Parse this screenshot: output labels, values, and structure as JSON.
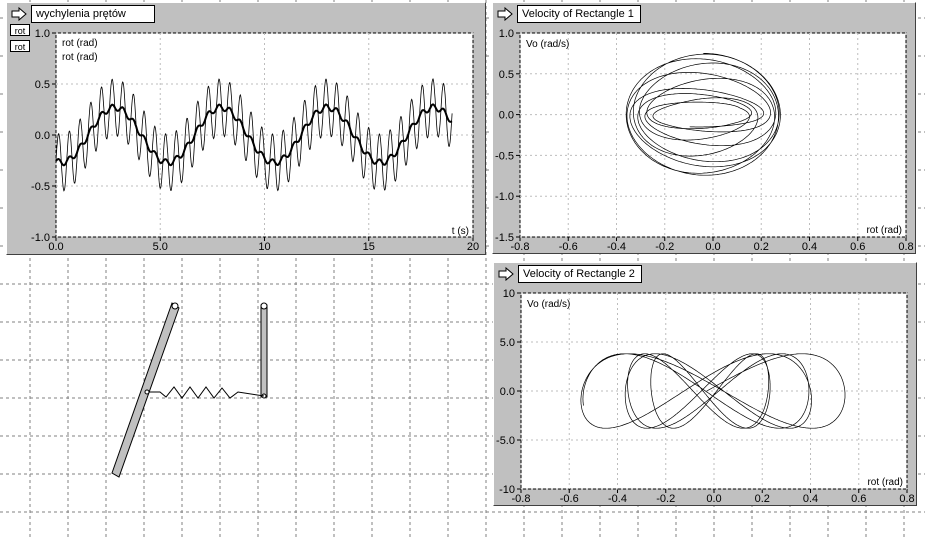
{
  "panels": {
    "p1": {
      "title": "wychylenia prętów",
      "legend": [
        "rot (rad)",
        "rot (rad)"
      ],
      "xlabel": "t (s)"
    },
    "p2": {
      "title": "Velocity of Rectangle 1",
      "ylabel": "Vo (rad/s)",
      "xlabel": "rot (rad)"
    },
    "p3": {
      "title": "Velocity of Rectangle 2",
      "ylabel": "Vo (rad/s)",
      "xlabel": "rot (rad)"
    }
  },
  "side_buttons": [
    "rot",
    "rot"
  ],
  "chart_data": [
    {
      "type": "line",
      "title": "wychylenia prętów",
      "xlabel": "t (s)",
      "ylabel": "",
      "xlim": [
        0,
        20
      ],
      "ylim": [
        -1.0,
        1.0
      ],
      "xticks": [
        "0.0",
        "5.0",
        "10",
        "15",
        "20"
      ],
      "yticks": [
        "1.0",
        "0.5",
        "0.0",
        "-0.5",
        "-1.0"
      ],
      "series": [
        {
          "name": "rot (rad)",
          "description": "thin line, amplitude ~0.55 oscillating around slow wave",
          "x": [
            0,
            1,
            2,
            3,
            4,
            5,
            6,
            7,
            8,
            9,
            10,
            11,
            12,
            13,
            14,
            15,
            16,
            17,
            18,
            19
          ],
          "y": [
            -0.25,
            -0.1,
            0.1,
            0.25,
            0.2,
            -0.1,
            -0.25,
            0,
            0.22,
            0.25,
            -0.05,
            -0.25,
            -0.1,
            0.2,
            0.22,
            -0.1,
            -0.25,
            0.05,
            0.2,
            0.1
          ]
        },
        {
          "name": "rot (rad)",
          "description": "thick line, slow wave amplitude ~0.25",
          "x": [
            0,
            1,
            2,
            3,
            4,
            5,
            6,
            7,
            8,
            9,
            10,
            11,
            12,
            13,
            14,
            15,
            16,
            17,
            18,
            19
          ],
          "y": [
            -0.25,
            -0.1,
            0.1,
            0.25,
            0.2,
            -0.1,
            -0.25,
            0,
            0.22,
            0.25,
            -0.05,
            -0.25,
            -0.1,
            0.2,
            0.22,
            -0.1,
            -0.25,
            0.05,
            0.2,
            0.1
          ]
        }
      ]
    },
    {
      "type": "line",
      "title": "Velocity of Rectangle 1",
      "xlabel": "rot (rad)",
      "ylabel": "Vo (rad/s)",
      "xlim": [
        -0.8,
        0.8
      ],
      "ylim": [
        -1.5,
        1.0
      ],
      "xticks": [
        "-0.8",
        "-0.6",
        "-0.4",
        "-0.2",
        "0.0",
        "0.2",
        "0.4",
        "0.6",
        "0.8"
      ],
      "yticks": [
        "1.0",
        "0.5",
        "0.0",
        "-0.5",
        "-1.0",
        "-1.5"
      ],
      "phase": {
        "x_amp": 0.32,
        "y_amp": 0.75,
        "x_center": -0.04,
        "y_center": 0.0
      }
    },
    {
      "type": "line",
      "title": "Velocity of Rectangle 2",
      "xlabel": "rot (rad)",
      "ylabel": "Vo (rad/s)",
      "xlim": [
        -0.8,
        0.8
      ],
      "ylim": [
        -10,
        10
      ],
      "xticks": [
        "-0.8",
        "-0.6",
        "-0.4",
        "-0.2",
        "0.0",
        "0.2",
        "0.4",
        "0.6",
        "0.8"
      ],
      "yticks": [
        "10",
        "5.0",
        "0.0",
        "-5.0",
        "-10"
      ],
      "phase": {
        "x_amp": 0.58,
        "y_amp": 4.0,
        "x_center": -0.03,
        "y_center": 0.0
      }
    }
  ]
}
